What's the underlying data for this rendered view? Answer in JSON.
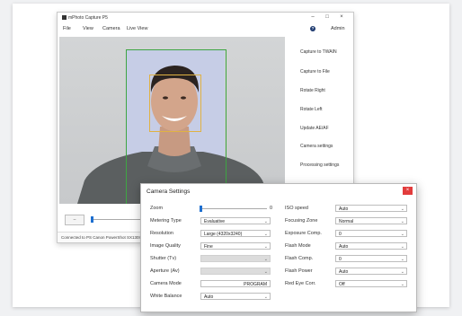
{
  "app": {
    "title": "mPhoto Capture P5",
    "controls": {
      "minimize": "–",
      "maximize": "□",
      "close": "×"
    },
    "menu": [
      "File",
      "View",
      "Camera",
      "Live View"
    ],
    "help_label": "?",
    "admin_label": "Admin"
  },
  "sidebar": {
    "items": [
      "Capture to TWAIN",
      "Capture to File",
      "Rotate Right",
      "Rotate Left",
      "Update AE/AF",
      "Camera settings",
      "Processing settings"
    ]
  },
  "bottom": {
    "button_label": "–",
    "status": "Connected to PS Canon PowerShot SX130IS"
  },
  "dialog": {
    "title": "Camera Settings",
    "close_label": "×",
    "left": [
      {
        "label": "Zoom",
        "kind": "slider",
        "value": "0",
        "level": 0
      },
      {
        "label": "Metering Type",
        "kind": "select",
        "value": "Evaluative"
      },
      {
        "label": "Resolution",
        "kind": "select",
        "value": "Large (4320x3240)"
      },
      {
        "label": "Image Quality",
        "kind": "select",
        "value": "Fine"
      },
      {
        "label": "Shutter (Tv)",
        "kind": "disabled",
        "value": ""
      },
      {
        "label": "Aperture (Av)",
        "kind": "disabled",
        "value": ""
      },
      {
        "label": "Camera Mode",
        "kind": "text",
        "value": "PROGRAM"
      },
      {
        "label": "White Balance",
        "kind": "select",
        "value": "Auto"
      }
    ],
    "right": [
      {
        "label": "ISO speed",
        "value": "Auto"
      },
      {
        "label": "Focusing Zone",
        "value": "Normal"
      },
      {
        "label": "Exposure Comp.",
        "value": "0"
      },
      {
        "label": "Flash Mode",
        "value": "Auto"
      },
      {
        "label": "Flash Comp.",
        "value": "0"
      },
      {
        "label": "Flash Power",
        "value": "Auto"
      },
      {
        "label": "Red Eye Corr.",
        "value": "Off"
      }
    ],
    "chevron": "⌄"
  }
}
